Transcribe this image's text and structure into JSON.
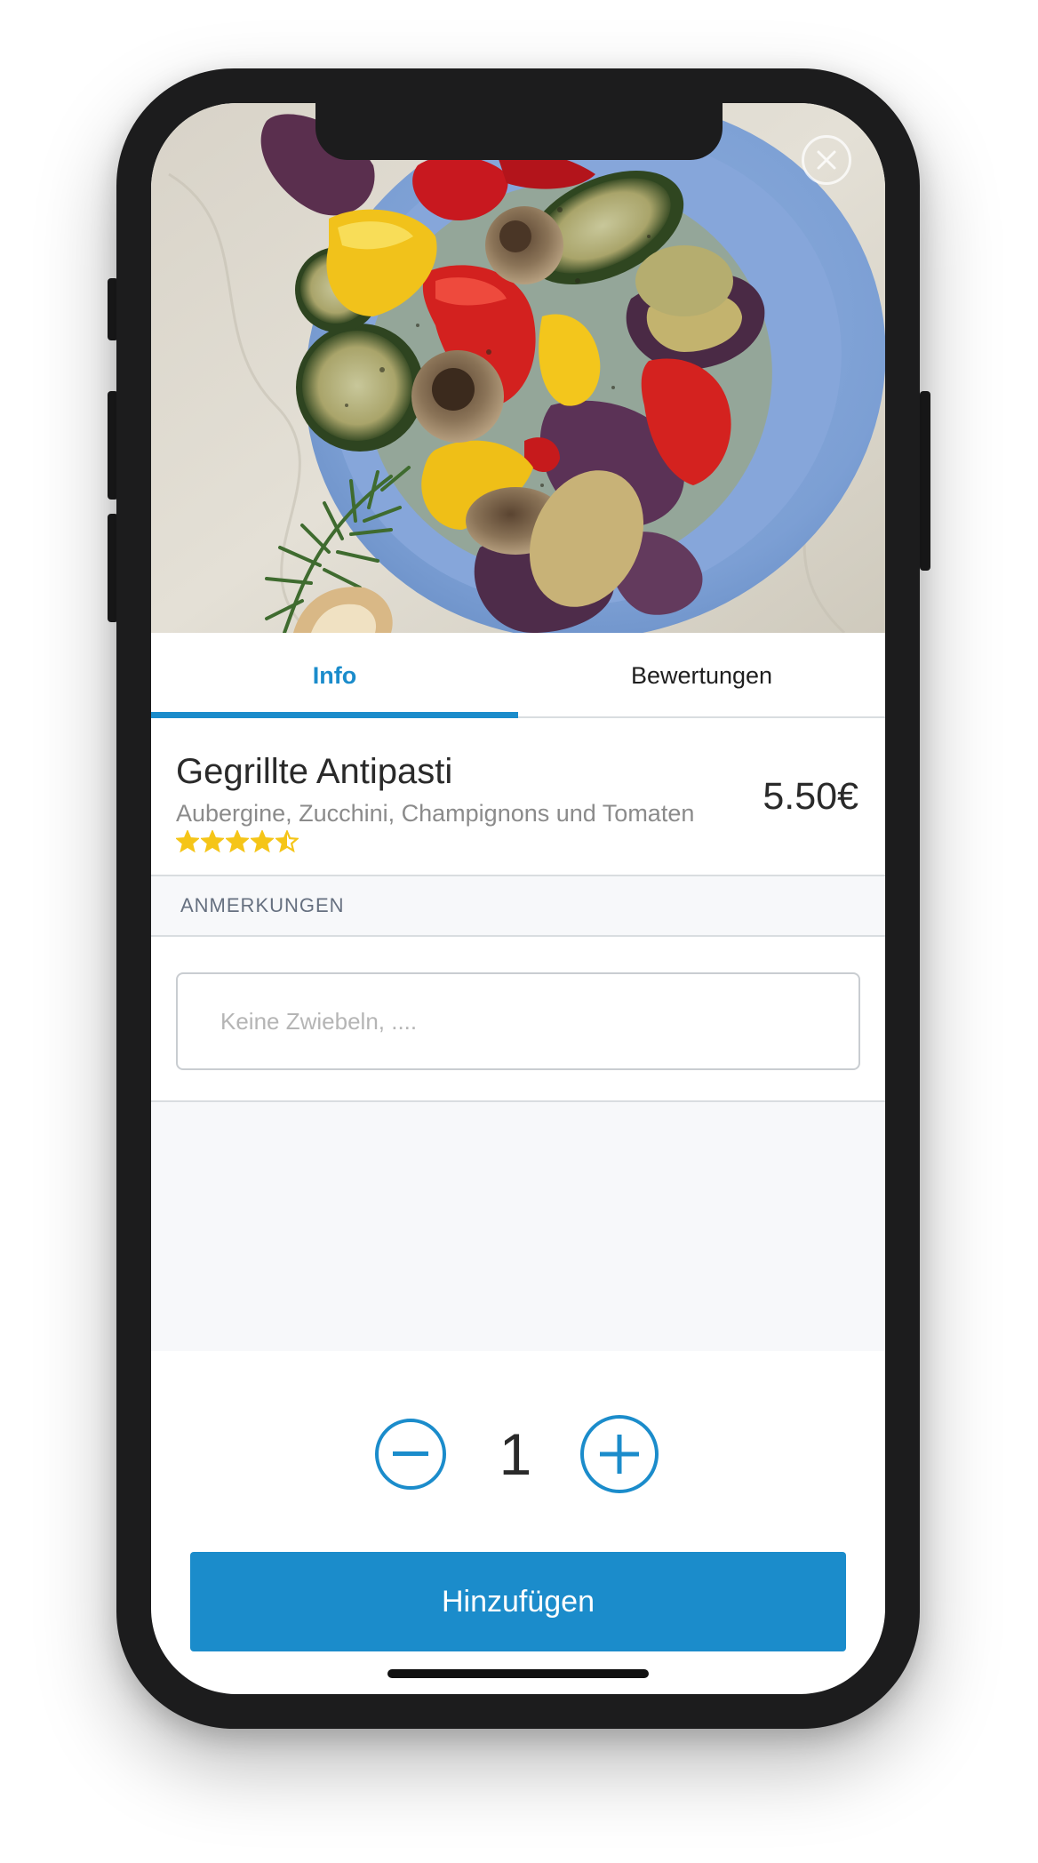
{
  "tabs": [
    {
      "label": "Info",
      "active": true
    },
    {
      "label": "Bewertungen",
      "active": false
    }
  ],
  "product": {
    "title": "Gegrillte Antipasti",
    "description": "Aubergine, Zucchini, Champignons und Tomaten",
    "price": "5.50€",
    "rating": 4.5,
    "rating_max": 5
  },
  "notes": {
    "section_label": "ANMERKUNGEN",
    "placeholder": "Keine Zwiebeln, ....",
    "value": ""
  },
  "quantity": {
    "value": "1",
    "decrement_icon": "minus-circle-icon",
    "increment_icon": "plus-circle-icon"
  },
  "actions": {
    "add_label": "Hinzufügen",
    "close_icon": "close-icon"
  },
  "colors": {
    "accent": "#1b8ccb",
    "star": "#f5c518",
    "section_bg": "#f7f8fa",
    "frame": "#1c1c1d"
  }
}
